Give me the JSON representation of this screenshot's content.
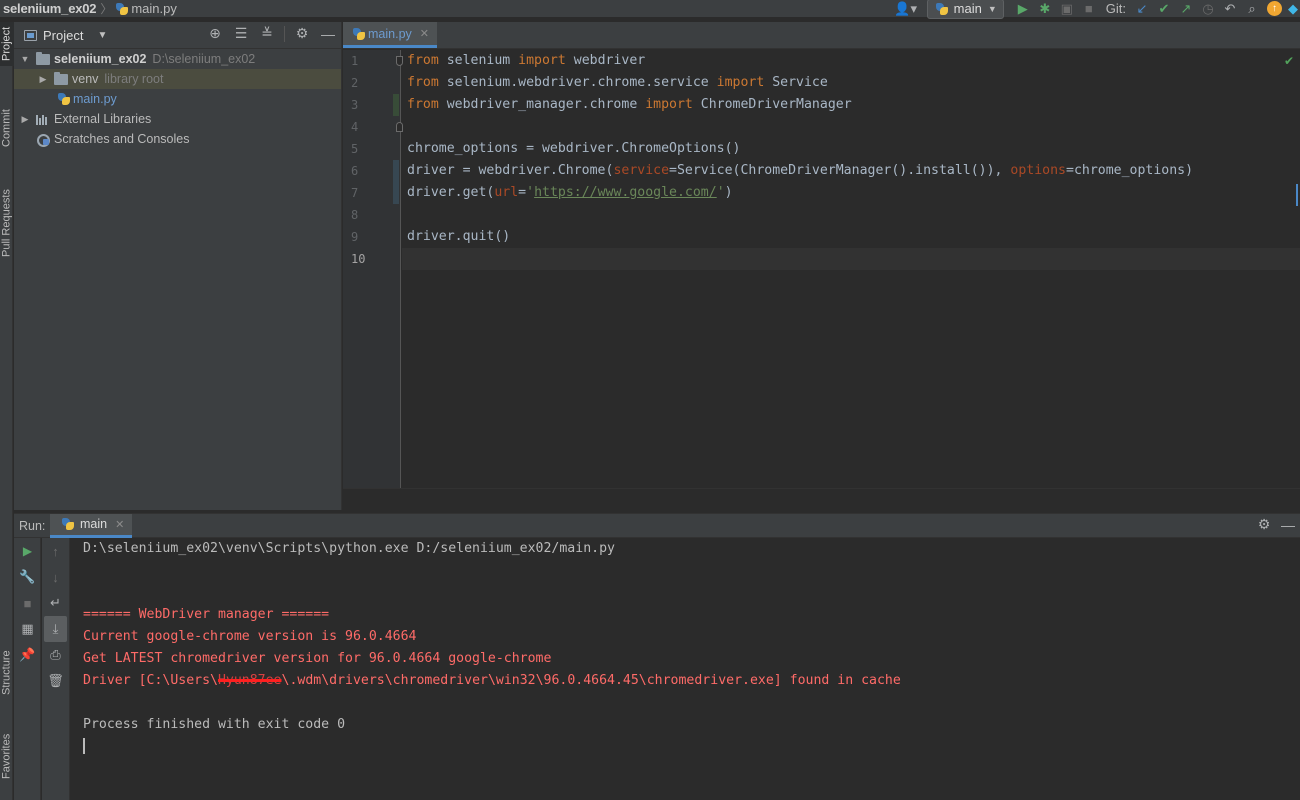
{
  "navbar": {
    "project": "seleniium_ex02",
    "file": "main.py"
  },
  "toolbar": {
    "run_config": "main",
    "git_label": "Git:"
  },
  "left_strip": {
    "project_tab": "Project",
    "commit_tab": "Commit",
    "pull_requests_tab": "Pull Requests",
    "structure_tab": "Structure",
    "favorites_tab": "Favorites"
  },
  "project_panel": {
    "title": "Project",
    "root": {
      "name": "seleniium_ex02",
      "path": "D:\\seleniium_ex02"
    },
    "venv": {
      "name": "venv",
      "hint": "library root"
    },
    "main_file": "main.py",
    "external_libraries": "External Libraries",
    "scratches": "Scratches and Consoles"
  },
  "editor": {
    "tab": "main.py",
    "line_numbers": [
      "1",
      "2",
      "3",
      "4",
      "5",
      "6",
      "7",
      "8",
      "9",
      "10"
    ],
    "code": {
      "l1": {
        "kw1": "from",
        "mod": " selenium ",
        "kw2": "import",
        "name": " webdriver"
      },
      "l2": {
        "kw1": "from",
        "mod": " selenium.webdriver.chrome.service ",
        "kw2": "import",
        "name": " Service"
      },
      "l3": {
        "kw1": "from",
        "mod": " webdriver_manager.chrome ",
        "kw2": "import",
        "name": " ChromeDriverManager"
      },
      "l5": "chrome_options = webdriver.ChromeOptions()",
      "l6": {
        "a": "driver = webdriver.Chrome(",
        "p1": "service",
        "b": "=Service(ChromeDriverManager().install()), ",
        "p2": "options",
        "c": "=chrome_options)"
      },
      "l7": {
        "a": "driver.get(",
        "p": "url",
        "b": "=",
        "q1": "'",
        "url": "https://www.google.com/",
        "q2": "'",
        "c": ")"
      },
      "l9": "driver.quit()"
    }
  },
  "run_panel": {
    "label": "Run:",
    "tab": "main",
    "console": {
      "cmd": "D:\\seleniium_ex02\\venv\\Scripts\\python.exe D:/seleniium_ex02/main.py",
      "wdm_header": "====== WebDriver manager ======",
      "chrome_version": "Current google-chrome version is 96.0.4664",
      "latest": "Get LATEST chromedriver version for 96.0.4664 google-chrome",
      "driver_prefix": "Driver [C:\\Users\\",
      "driver_user": "Hyun87ee",
      "driver_suffix": "\\.wdm\\drivers\\chromedriver\\win32\\96.0.4664.45\\chromedriver.exe] found in cache",
      "exit": "Process finished with exit code 0"
    }
  },
  "colors": {
    "keyword": "#cc7832",
    "param": "#aa4926",
    "string": "#6a8759",
    "error_output": "#ff6b68",
    "accent": "#4a88c7"
  }
}
